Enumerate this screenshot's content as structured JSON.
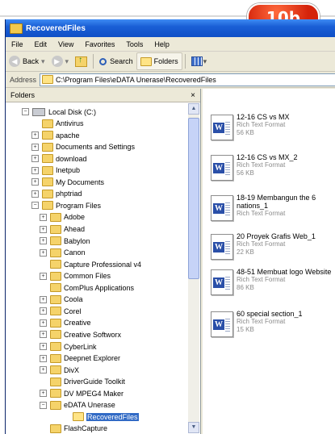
{
  "badge": "10b",
  "window": {
    "title": "RecoveredFiles"
  },
  "menu": [
    "File",
    "Edit",
    "View",
    "Favorites",
    "Tools",
    "Help"
  ],
  "toolbar": {
    "back": "Back",
    "search": "Search",
    "folders": "Folders"
  },
  "address": {
    "label": "Address",
    "value": "C:\\Program Files\\eDATA Unerase\\RecoveredFiles"
  },
  "folders_pane": {
    "title": "Folders",
    "close": "×",
    "tree": [
      {
        "label": "Local Disk (C:)",
        "level": 0,
        "expander": "−",
        "icon": "drive"
      },
      {
        "label": "Antivirus",
        "level": 1,
        "expander": ""
      },
      {
        "label": "apache",
        "level": 1,
        "expander": "+"
      },
      {
        "label": "Documents and Settings",
        "level": 1,
        "expander": "+"
      },
      {
        "label": "download",
        "level": 1,
        "expander": "+"
      },
      {
        "label": "Inetpub",
        "level": 1,
        "expander": "+"
      },
      {
        "label": "My Documents",
        "level": 1,
        "expander": "+"
      },
      {
        "label": "phptriad",
        "level": 1,
        "expander": "+"
      },
      {
        "label": "Program Files",
        "level": 1,
        "expander": "−"
      },
      {
        "label": "Adobe",
        "level": 2,
        "expander": "+"
      },
      {
        "label": "Ahead",
        "level": 2,
        "expander": "+"
      },
      {
        "label": "Babylon",
        "level": 2,
        "expander": "+"
      },
      {
        "label": "Canon",
        "level": 2,
        "expander": "+"
      },
      {
        "label": "Capture Professional v4",
        "level": 2,
        "expander": ""
      },
      {
        "label": "Common Files",
        "level": 2,
        "expander": "+"
      },
      {
        "label": "ComPlus Applications",
        "level": 2,
        "expander": ""
      },
      {
        "label": "Coola",
        "level": 2,
        "expander": "+"
      },
      {
        "label": "Corel",
        "level": 2,
        "expander": "+"
      },
      {
        "label": "Creative",
        "level": 2,
        "expander": "+"
      },
      {
        "label": "Creative Softworx",
        "level": 2,
        "expander": "+"
      },
      {
        "label": "CyberLink",
        "level": 2,
        "expander": "+"
      },
      {
        "label": "Deepnet Explorer",
        "level": 2,
        "expander": "+"
      },
      {
        "label": "DivX",
        "level": 2,
        "expander": "+"
      },
      {
        "label": "DriverGuide Toolkit",
        "level": 2,
        "expander": ""
      },
      {
        "label": "DV MPEG4 Maker",
        "level": 2,
        "expander": "+"
      },
      {
        "label": "eDATA Unerase",
        "level": 2,
        "expander": "−"
      },
      {
        "label": "RecoveredFiles",
        "level": 3,
        "expander": "",
        "selected": true
      },
      {
        "label": "FlashCapture",
        "level": 2,
        "expander": ""
      }
    ]
  },
  "files": [
    {
      "name": "12-16 CS vs MX",
      "type": "Rich Text Format",
      "size": "56 KB"
    },
    {
      "name": "12-16 CS vs MX_2",
      "type": "Rich Text Format",
      "size": "56 KB"
    },
    {
      "name": "18-19 Membangun the 6 nations_1",
      "type": "Rich Text Format",
      "size": ""
    },
    {
      "name": "20 Proyek Grafis Web_1",
      "type": "Rich Text Format",
      "size": "22 KB"
    },
    {
      "name": "48-51 Membuat logo Website",
      "type": "Rich Text Format",
      "size": "86 KB"
    },
    {
      "name": "60 special section_1",
      "type": "Rich Text Format",
      "size": "15 KB"
    }
  ],
  "colors": {
    "titlebar": "#1a5fd6",
    "selection": "#316ac5",
    "badge": "#d4230b"
  }
}
